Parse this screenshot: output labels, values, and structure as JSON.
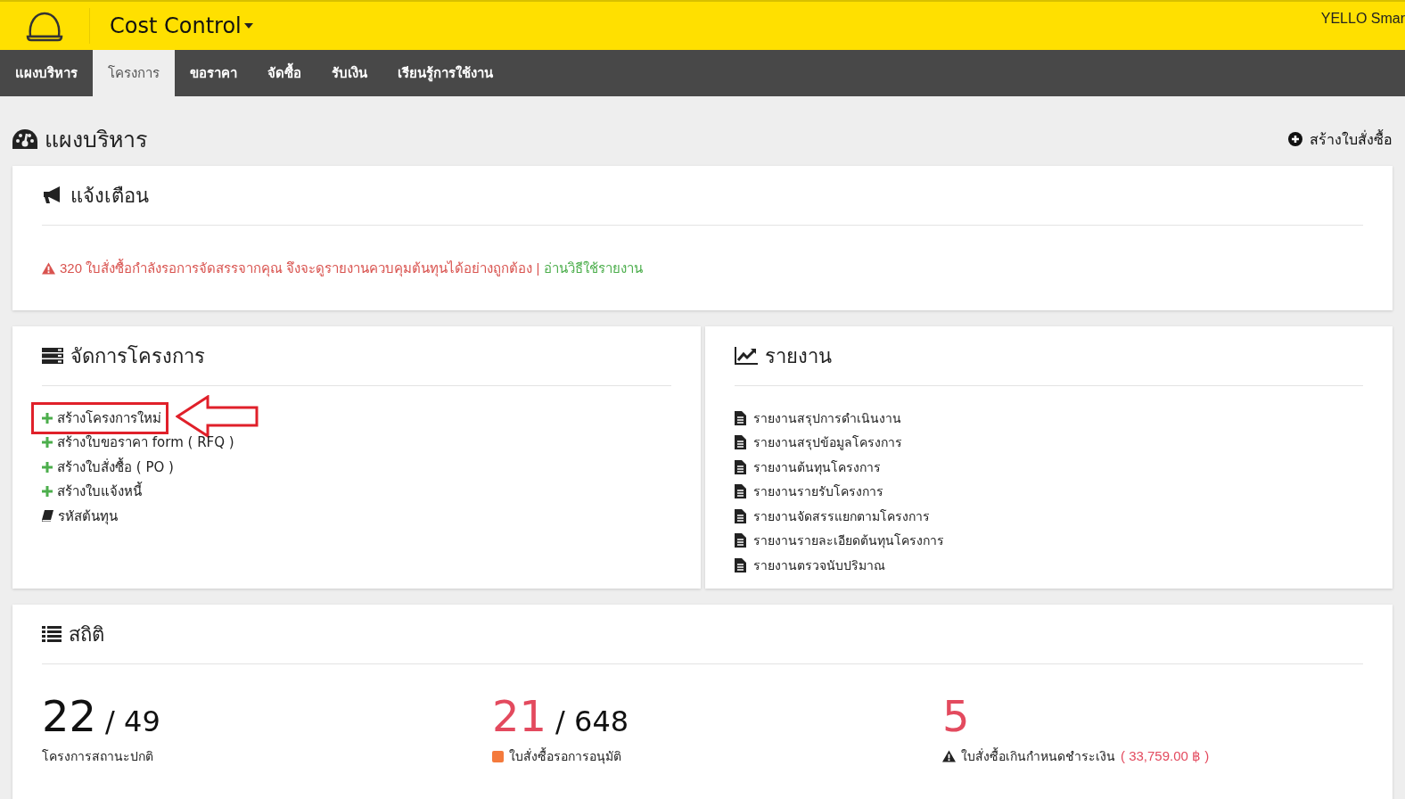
{
  "header": {
    "app_title": "Cost Control",
    "user": "YELLO Smar"
  },
  "nav": [
    {
      "label": "แผงบริหาร",
      "selected": false
    },
    {
      "label": "โครงการ",
      "selected": true
    },
    {
      "label": "ขอราคา",
      "selected": false
    },
    {
      "label": "จัดซื้อ",
      "selected": false
    },
    {
      "label": "รับเงิน",
      "selected": false
    },
    {
      "label": "เรียนรู้การใช้งาน",
      "selected": false
    }
  ],
  "page": {
    "title": "แผงบริหาร",
    "action": "สร้างใบสั่งซื้อ"
  },
  "alerts": {
    "title": "แจ้งเตือน",
    "message": "320 ใบสั่งซื้อกำลังรอการจัดสรรจากคุณ จึงจะดูรายงานควบคุมต้นทุนได้อย่างถูกต้อง |",
    "link": "อ่านวิธีใช้รายงาน"
  },
  "projects": {
    "title": "จัดการโครงการ",
    "items": [
      {
        "kind": "create",
        "label": "สร้างโครงการใหม่",
        "highlighted": true
      },
      {
        "kind": "create",
        "label": "สร้างใบขอราคา form ( RFQ )",
        "highlighted": false
      },
      {
        "kind": "create",
        "label": "สร้างใบสั่งซื้อ ( PO )",
        "highlighted": false
      },
      {
        "kind": "create",
        "label": "สร้างใบแจ้งหนี้",
        "highlighted": false
      },
      {
        "kind": "codes",
        "label": "รหัสต้นทุน",
        "highlighted": false
      }
    ]
  },
  "reports": {
    "title": "รายงาน",
    "items": [
      "รายงานสรุปการดำเนินงาน",
      "รายงานสรุปข้อมูลโครงการ",
      "รายงานต้นทุนโครงการ",
      "รายงานรายรับโครงการ",
      "รายงานจัดสรรแยกตามโครงการ",
      "รายงานรายละเอียดต้นทุนโครงการ",
      "รายงานตรวจนับปริมาณ"
    ]
  },
  "stats": {
    "title": "สถิติ",
    "items": [
      {
        "value": "22",
        "total": "/ 49",
        "alert": false,
        "kind": "plain",
        "label": "โครงการสถานะปกติ"
      },
      {
        "value": "21",
        "total": "/ 648",
        "alert": true,
        "kind": "pending",
        "label": "ใบสั่งซื้อรอการอนุมัติ"
      },
      {
        "value": "5",
        "alert": true,
        "kind": "overdue",
        "label": "ใบสั่งซื้อเกินกำหนดชำระเงิน",
        "amount": "( 33,759.00 ฿ )"
      }
    ]
  }
}
